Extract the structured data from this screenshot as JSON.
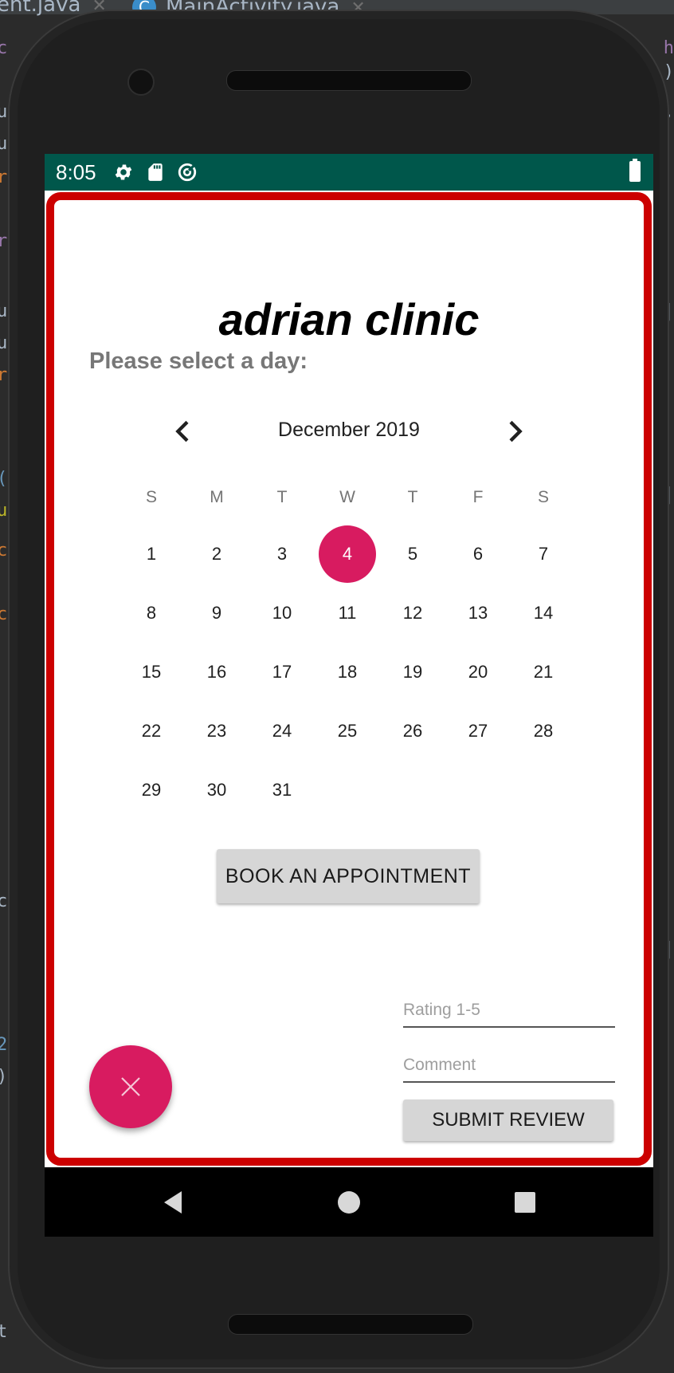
{
  "ide": {
    "tab1_label": "ent.java",
    "tab2_label": "MainActivity.java"
  },
  "statusbar": {
    "time": "8:05",
    "icons": [
      "settings-icon",
      "sd-card-icon",
      "data-saver-icon",
      "battery-icon"
    ]
  },
  "app": {
    "title": "adrian clinic",
    "subtitle": "Please select a day:",
    "calendar": {
      "month_label": "December 2019",
      "prev_icon": "chevron-left-icon",
      "next_icon": "chevron-right-icon",
      "weekdays": [
        "S",
        "M",
        "T",
        "W",
        "T",
        "F",
        "S"
      ],
      "weeks": [
        [
          "1",
          "2",
          "3",
          "4",
          "5",
          "6",
          "7"
        ],
        [
          "8",
          "9",
          "10",
          "11",
          "12",
          "13",
          "14"
        ],
        [
          "15",
          "16",
          "17",
          "18",
          "19",
          "20",
          "21"
        ],
        [
          "22",
          "23",
          "24",
          "25",
          "26",
          "27",
          "28"
        ],
        [
          "29",
          "30",
          "31",
          "",
          "",
          "",
          ""
        ]
      ],
      "selected_day": "4",
      "accent_color": "#d81b60"
    },
    "book_button": "BOOK AN APPOINTMENT",
    "rating_placeholder": "Rating 1-5",
    "comment_placeholder": "Comment",
    "submit_button": "SUBMIT REVIEW",
    "fab_icon": "close-icon",
    "border_color": "#cc0000",
    "statusbar_color": "#00574b"
  },
  "navbar": {
    "icons": [
      "back-icon",
      "home-icon",
      "recents-icon"
    ]
  }
}
